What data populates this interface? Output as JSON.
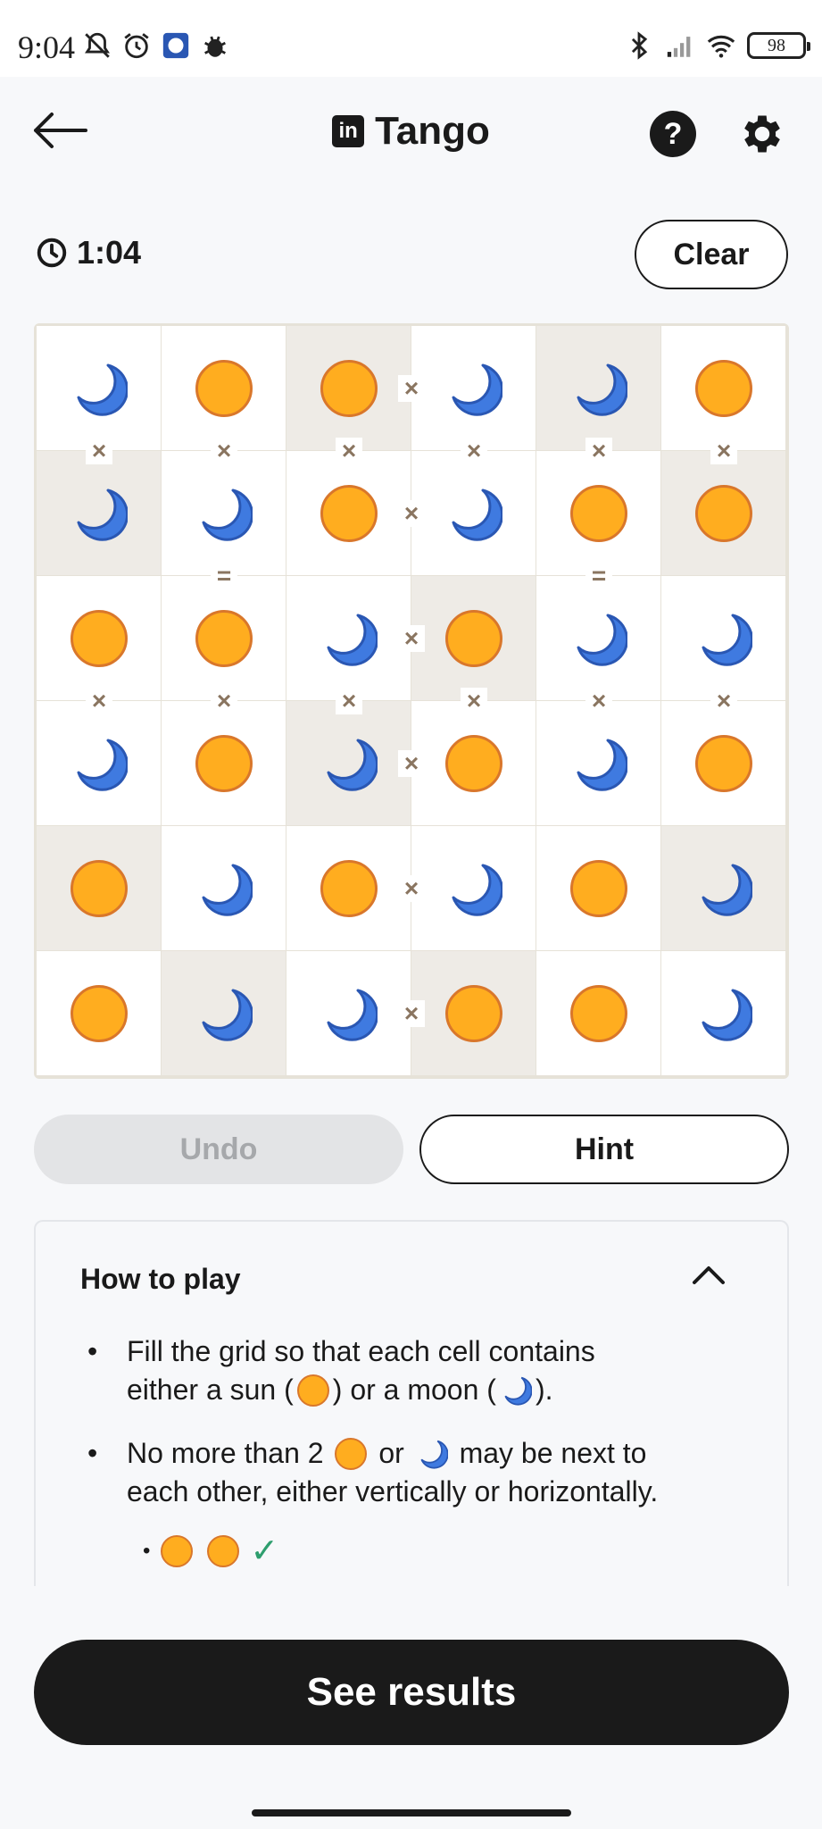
{
  "status_bar": {
    "time": "9:04",
    "battery": "98",
    "left_icons": [
      "bell-off-icon",
      "alarm-icon",
      "app-icon",
      "bug-icon"
    ],
    "right_icons": [
      "bluetooth-icon",
      "signal-icon",
      "wifi-icon"
    ]
  },
  "header": {
    "title": "Tango",
    "logo_text": "in",
    "help_label": "?"
  },
  "timer": {
    "value": "1:04"
  },
  "clear_label": "Clear",
  "grid": {
    "rows": [
      [
        {
          "v": "moon",
          "locked": false
        },
        {
          "v": "sun",
          "locked": false
        },
        {
          "v": "sun",
          "locked": true
        },
        {
          "v": "moon",
          "locked": false
        },
        {
          "v": "moon",
          "locked": true
        },
        {
          "v": "sun",
          "locked": false
        }
      ],
      [
        {
          "v": "moon",
          "locked": true
        },
        {
          "v": "moon",
          "locked": false
        },
        {
          "v": "sun",
          "locked": false
        },
        {
          "v": "moon",
          "locked": false
        },
        {
          "v": "sun",
          "locked": false
        },
        {
          "v": "sun",
          "locked": true
        }
      ],
      [
        {
          "v": "sun",
          "locked": false
        },
        {
          "v": "sun",
          "locked": false
        },
        {
          "v": "moon",
          "locked": false
        },
        {
          "v": "sun",
          "locked": true
        },
        {
          "v": "moon",
          "locked": false
        },
        {
          "v": "moon",
          "locked": false
        }
      ],
      [
        {
          "v": "moon",
          "locked": false
        },
        {
          "v": "sun",
          "locked": false
        },
        {
          "v": "moon",
          "locked": true
        },
        {
          "v": "sun",
          "locked": false
        },
        {
          "v": "moon",
          "locked": false
        },
        {
          "v": "sun",
          "locked": false
        }
      ],
      [
        {
          "v": "sun",
          "locked": true
        },
        {
          "v": "moon",
          "locked": false
        },
        {
          "v": "sun",
          "locked": false
        },
        {
          "v": "moon",
          "locked": false
        },
        {
          "v": "sun",
          "locked": false
        },
        {
          "v": "moon",
          "locked": true
        }
      ],
      [
        {
          "v": "sun",
          "locked": false
        },
        {
          "v": "moon",
          "locked": true
        },
        {
          "v": "moon",
          "locked": false
        },
        {
          "v": "sun",
          "locked": true
        },
        {
          "v": "sun",
          "locked": false
        },
        {
          "v": "moon",
          "locked": false
        }
      ]
    ],
    "horizontal_constraints": [
      {
        "row": 0,
        "col": 2,
        "sym": "×"
      },
      {
        "row": 1,
        "col": 2,
        "sym": "×"
      },
      {
        "row": 2,
        "col": 2,
        "sym": "×"
      },
      {
        "row": 3,
        "col": 2,
        "sym": "×"
      },
      {
        "row": 4,
        "col": 2,
        "sym": "×"
      },
      {
        "row": 5,
        "col": 2,
        "sym": "×"
      }
    ],
    "vertical_constraints": [
      {
        "row": 1,
        "col": 0,
        "sym": "×"
      },
      {
        "row": 1,
        "col": 1,
        "sym": "×"
      },
      {
        "row": 1,
        "col": 2,
        "sym": "×"
      },
      {
        "row": 1,
        "col": 3,
        "sym": "×"
      },
      {
        "row": 1,
        "col": 4,
        "sym": "×"
      },
      {
        "row": 1,
        "col": 5,
        "sym": "×"
      },
      {
        "row": 2,
        "col": 1,
        "sym": "="
      },
      {
        "row": 2,
        "col": 4,
        "sym": "="
      },
      {
        "row": 3,
        "col": 0,
        "sym": "×"
      },
      {
        "row": 3,
        "col": 1,
        "sym": "×"
      },
      {
        "row": 3,
        "col": 2,
        "sym": "×"
      },
      {
        "row": 3,
        "col": 3,
        "sym": "×"
      },
      {
        "row": 3,
        "col": 4,
        "sym": "×"
      },
      {
        "row": 3,
        "col": 5,
        "sym": "×"
      }
    ]
  },
  "buttons": {
    "undo": "Undo",
    "hint": "Hint",
    "results": "See results"
  },
  "how_to_play": {
    "title": "How to play",
    "rule1_a": "Fill the grid so that each cell contains",
    "rule1_b_pre": "either a sun (",
    "rule1_b_mid": ") or a moon (",
    "rule1_b_post": ").",
    "rule2_pre": "No more than 2",
    "rule2_mid": "or",
    "rule2_post": "may be next to",
    "rule2_b": "each other, either vertically or horizontally.",
    "example_check": "✓"
  },
  "colors": {
    "sun": "#ffad1f",
    "sun_border": "#d9772b",
    "moon": "#3f7ae0",
    "moon_dark": "#2a57b3",
    "locked_cell": "#eeebe6",
    "marker": "#8a7560"
  }
}
